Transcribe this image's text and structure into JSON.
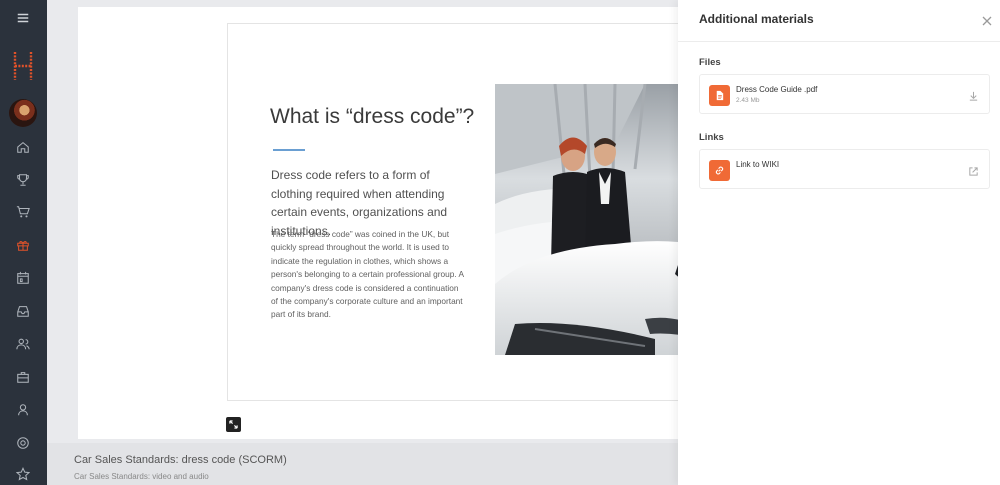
{
  "sidebar": {
    "icons": [
      "menu-icon",
      "home-icon",
      "trophy-icon",
      "cart-icon",
      "gift-icon",
      "calendar-icon",
      "inbox-icon",
      "people-icon",
      "briefcase-icon",
      "user-icon",
      "target-icon",
      "star-icon"
    ],
    "active_color": "#e0522a",
    "background": "#2b323c"
  },
  "slide": {
    "title": "What is “dress code”?",
    "lead": "Dress code refers to a form of clothing required when attending certain events, organizations and institutions.",
    "body": "The term “dress code” was coined in the UK, but quickly spread throughout the world. It is used to indicate the regulation in clothes, which shows a person's belonging to a certain professional group. A company's dress code is considered a continuation of the company's corporate culture and an important part of its brand."
  },
  "course": {
    "title": "Car Sales Standards: dress code (SCORM)",
    "subtitle": "Car Sales Standards: video and audio"
  },
  "panel": {
    "title": "Additional materials",
    "files_heading": "Files",
    "links_heading": "Links",
    "files": [
      {
        "name": "Dress Code Guide .pdf",
        "size": "2.43 Mb",
        "icon": "document-icon",
        "action_icon": "download-icon"
      }
    ],
    "links": [
      {
        "name": "Link to WIKI",
        "icon": "link-icon",
        "action_icon": "external-link-icon"
      }
    ],
    "accent": "#f06a36"
  }
}
